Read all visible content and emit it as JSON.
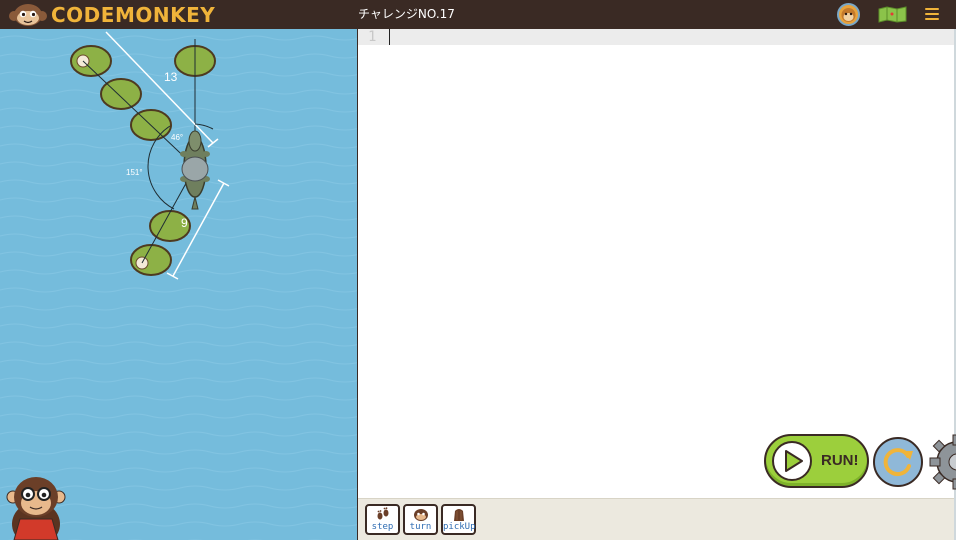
{
  "header": {
    "logo_text": "CODEMONKEY",
    "challenge_title": "チャレンジNO.17"
  },
  "game": {
    "measure_distance_top": "13",
    "measure_distance_bottom": "9",
    "angle_small": "46°",
    "angle_large": "151°"
  },
  "editor": {
    "line_number": "1",
    "code": ""
  },
  "controls": {
    "run_label": "RUN!"
  },
  "commands": [
    {
      "label": "step",
      "icon": "footprints-icon"
    },
    {
      "label": "turn",
      "icon": "turn-icon"
    },
    {
      "label": "pickUp",
      "icon": "pickup-icon"
    }
  ],
  "colors": {
    "topbar": "#3a2a24",
    "accent": "#f0b43a",
    "water": "#75bcdc",
    "run_button": "#9ccf3c",
    "reset_button": "#8fb8d8",
    "command_text": "#2f6db3"
  }
}
